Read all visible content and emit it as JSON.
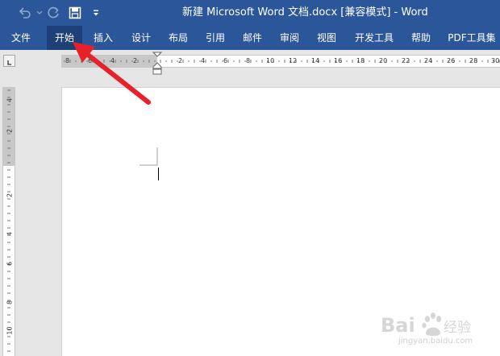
{
  "window": {
    "title": "新建 Microsoft Word 文档.docx [兼容模式]  -  Word"
  },
  "quick_access": {
    "undo_icon": "undo-icon",
    "redo_icon": "redo-icon",
    "save_icon": "save-icon",
    "customize_icon": "customize-qat-icon"
  },
  "ribbon": {
    "tabs": [
      {
        "label": "文件"
      },
      {
        "label": "开始",
        "active": true
      },
      {
        "label": "插入"
      },
      {
        "label": "设计"
      },
      {
        "label": "布局"
      },
      {
        "label": "引用"
      },
      {
        "label": "邮件"
      },
      {
        "label": "审阅"
      },
      {
        "label": "视图"
      },
      {
        "label": "开发工具"
      },
      {
        "label": "帮助"
      },
      {
        "label": "PDF工具集"
      }
    ]
  },
  "ruler": {
    "horizontal_labels": [
      "8",
      "6",
      "4",
      "2",
      "2",
      "4",
      "6",
      "8",
      "10",
      "12",
      "14",
      "16",
      "18",
      "20",
      "22",
      "24",
      "26",
      "28",
      "30"
    ],
    "vertical_labels": [
      "4",
      "2",
      "2",
      "4",
      "6",
      "8",
      "10"
    ]
  },
  "watermark": {
    "brand": "Baidu经验",
    "url": "jingyan.baidu.com"
  },
  "colors": {
    "title_bar": "#2b579a",
    "active_tab": "#1d4077",
    "annotation_arrow": "#e8202a"
  }
}
